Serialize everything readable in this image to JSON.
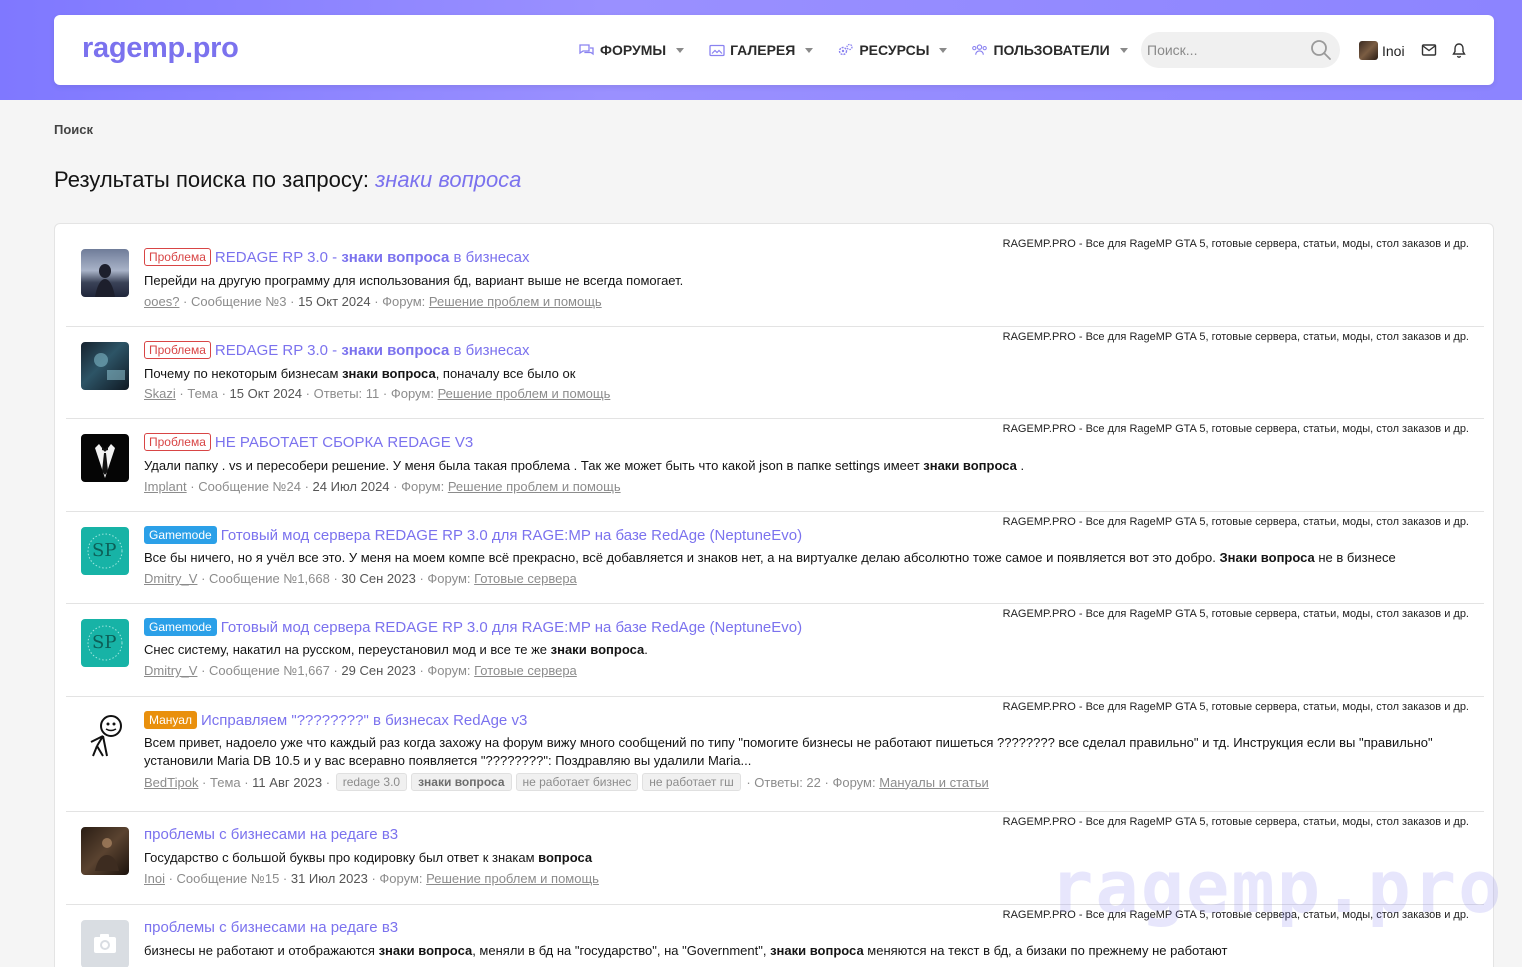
{
  "header": {
    "logo": "ragemp.pro",
    "nav": [
      {
        "label": "ФОРУМЫ",
        "icon": "comments-icon"
      },
      {
        "label": "ГАЛЕРЕЯ",
        "icon": "image-icon"
      },
      {
        "label": "РЕСУРСЫ",
        "icon": "cogs-icon"
      },
      {
        "label": "ПОЛЬЗОВАТЕЛИ",
        "icon": "users-icon"
      }
    ],
    "search_placeholder": "Поиск...",
    "username": "Inoi"
  },
  "breadcrumb": "Поиск",
  "title": {
    "prefix": "Результаты поиска по запросу: ",
    "query": "знаки вопроса"
  },
  "site_label": "RAGEMP.PRO - Все для RageMP GTA 5, готовые сервера, статьи, моды, стол заказов и др.",
  "results": [
    {
      "prefix": "Проблема",
      "title_a": "REDAGE RP 3.0 - ",
      "title_b": "знаки вопроса",
      "title_c": " в бизнесах",
      "snippet_a": "Перейди на другую программу для использования бд, вариант выше не всегда помогает.",
      "snippet_b": "",
      "snippet_c": "",
      "author": "ooes?",
      "type": "Сообщение №3",
      "date": "15 Окт 2024",
      "forum_label": "Форум:",
      "forum": "Решение проблем и помощь"
    },
    {
      "prefix": "Проблема",
      "title_a": "REDAGE RP 3.0 - ",
      "title_b": "знаки вопроса",
      "title_c": " в бизнесах",
      "snippet_a": "Почему по некоторым бизнесам ",
      "snippet_b": "знаки вопроса",
      "snippet_c": ", поначалу все было ок",
      "author": "Skazi",
      "type": "Тема",
      "date": "15 Окт 2024",
      "replies": "Ответы: 11",
      "forum_label": "Форум:",
      "forum": "Решение проблем и помощь"
    },
    {
      "prefix": "Проблема",
      "title_a": "НЕ РАБОТАЕТ СБОРКА REDAGE V3",
      "snippet_a": "Удали папку . vs и пересобери решение. У меня была такая проблема . Так же может быть что какой json в папке settings имеет ",
      "snippet_b": "знаки вопроса",
      "snippet_c": " .",
      "author": "Implant",
      "type": "Сообщение №24",
      "date": "24 Июл 2024",
      "forum_label": "Форум:",
      "forum": "Решение проблем и помощь"
    },
    {
      "prefix": "Gamemode",
      "title_a": "Готовый мод сервера REDAGE RP 3.0 для RAGE:MP на базе RedAge (NeptuneEvo)",
      "snippet_a": "Все бы ничего, но я учёл все это. У меня на моем компе всё прекрасно, всё добавляется и знаков нет, а на виртуалке делаю абсолютно тоже самое и появляется вот это добро. ",
      "snippet_b": "Знаки вопроса",
      "snippet_c": " не в бизнесе",
      "author": "Dmitry_V",
      "type": "Сообщение №1,668",
      "date": "30 Сен 2023",
      "forum_label": "Форум:",
      "forum": "Готовые сервера",
      "avatar_text": "SP"
    },
    {
      "prefix": "Gamemode",
      "title_a": "Готовый мод сервера REDAGE RP 3.0 для RAGE:MP на базе RedAge (NeptuneEvo)",
      "snippet_a": "Снес систему, накатил на русском, переустановил мод и все те же ",
      "snippet_b": "знаки вопроса",
      "snippet_c": ".",
      "author": "Dmitry_V",
      "type": "Сообщение №1,667",
      "date": "29 Сен 2023",
      "forum_label": "Форум:",
      "forum": "Готовые сервера",
      "avatar_text": "SP"
    },
    {
      "prefix": "Мануал",
      "title_a": "Исправляем \"????????\" в бизнесах RedAge v3",
      "snippet_a": "Всем привет, надоело уже что каждый раз когда захожу на форум вижу много сообщений по типу \"помогите бизнесы не работают пишеться ???????? все сделал правильно\" и тд. Инструкция если вы \"правильно\" установили Maria DB 10.5 и у вас всеравно появляется \"????????\": Поздравляю вы удалили Maria...",
      "author": "BedTipok",
      "type": "Тема",
      "date": "11 Авг 2023",
      "tags": [
        "redage 3.0",
        "знаки вопроса",
        "не работает бизнес",
        "не работает гш"
      ],
      "replies": "Ответы: 22",
      "forum_label": "Форум:",
      "forum": "Мануалы и статьи"
    },
    {
      "title_a": "проблемы с бизнесами на редаге в3",
      "snippet_a": "Государство с большой буквы про кодировку был ответ к знакам ",
      "snippet_b": "вопроса",
      "snippet_c": "",
      "author": "Inoi",
      "type": "Сообщение №15",
      "date": "31 Июл 2023",
      "forum_label": "Форум:",
      "forum": "Решение проблем и помощь"
    },
    {
      "title_a": "проблемы с бизнесами на редаге в3",
      "snippet_a": "бизнесы не работают и отображаются ",
      "snippet_b": "знаки вопроса",
      "snippet_c": ", меняли в бд на \"государство\", на \"Government\", ",
      "snippet_d": "знаки вопроса",
      "snippet_e": " меняются на текст в бд, а бизаки по прежнему не работают"
    }
  ],
  "watermark": "ragemp.pro",
  "colors": {
    "accent": "#7b72ee",
    "band": "#8c84ff",
    "problem": "#d84545",
    "gamemode": "#2ba0e8",
    "manual": "#e9900d"
  }
}
